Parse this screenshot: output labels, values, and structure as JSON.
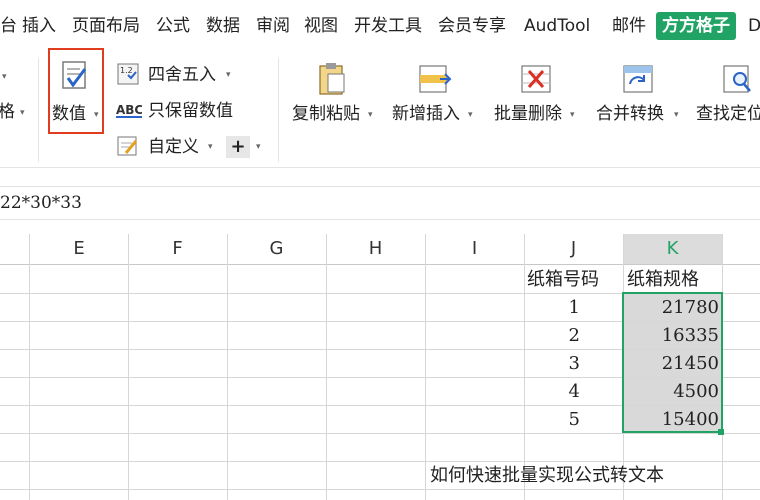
{
  "menu": {
    "items": [
      "台",
      "插入",
      "页面布局",
      "公式",
      "数据",
      "审阅",
      "视图",
      "开发工具",
      "会员专享",
      "AudTool",
      "邮件"
    ],
    "active": "方方格子",
    "overflow": "D"
  },
  "ribbon": {
    "left_label": "格",
    "number_button": "数值",
    "round": "四舍五入",
    "keep_values": "只保留数值",
    "custom": "自定义",
    "plus": "+",
    "copy_paste": "复制粘贴",
    "insert": "新增插入",
    "batch_delete": "批量删除",
    "merge_convert": "合并转换",
    "find_locate": "查找定位",
    "highlight_color": "#e03c1f"
  },
  "formula_bar": {
    "value": "22*30*33"
  },
  "sheet": {
    "columns": [
      "E",
      "F",
      "G",
      "H",
      "I",
      "J",
      "K"
    ],
    "selected_column": "K",
    "header_j": "纸箱号码",
    "header_k": "纸箱规格",
    "rows": [
      {
        "j": "1",
        "k": "21780"
      },
      {
        "j": "2",
        "k": "16335"
      },
      {
        "j": "3",
        "k": "21450"
      },
      {
        "j": "4",
        "k": "4500"
      },
      {
        "j": "5",
        "k": "15400"
      }
    ],
    "caption": "如何快速批量实现公式转文本",
    "accent": "#21a366"
  }
}
